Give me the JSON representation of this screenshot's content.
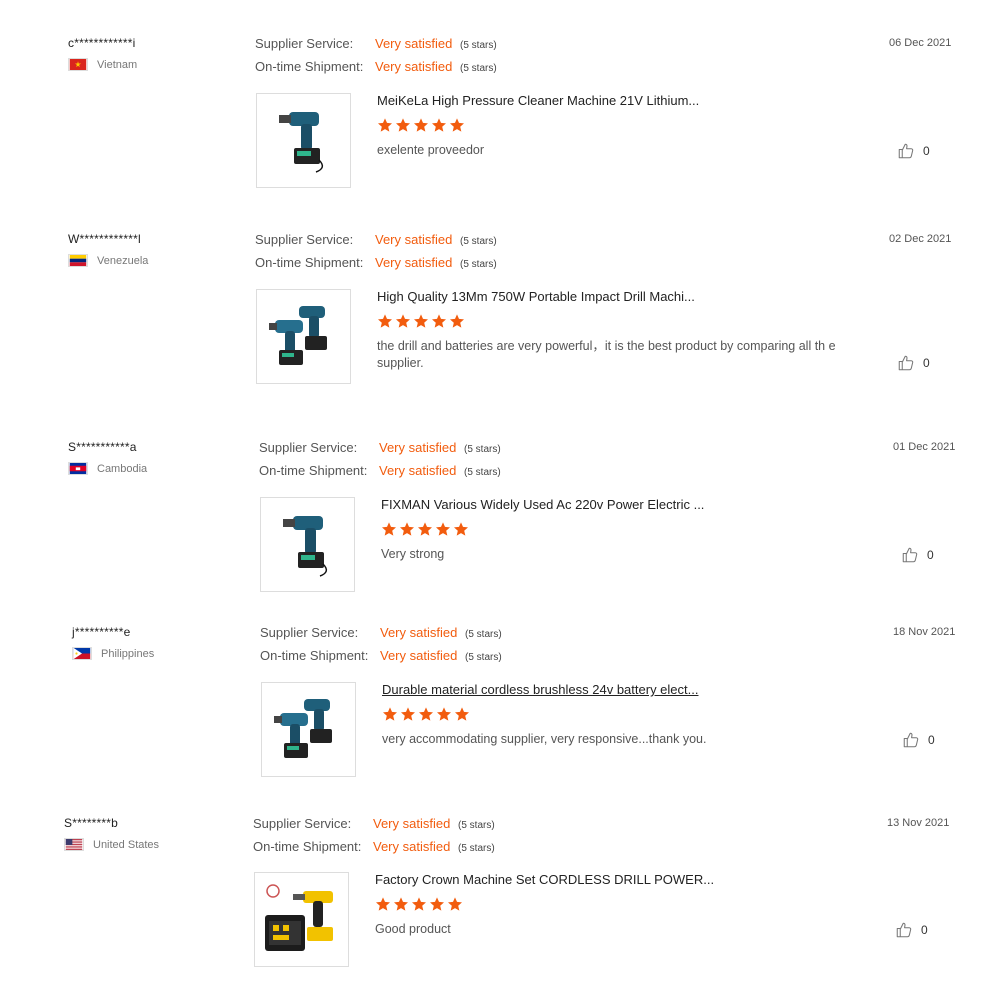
{
  "labels": {
    "supplier_service": "Supplier Service:",
    "ontime_shipment": "On-time Shipment:"
  },
  "colors": {
    "accent": "#f25c0e",
    "star": "#f25c0e"
  },
  "reviews": [
    {
      "user": "c************i",
      "country": "Vietnam",
      "flag": "vietnam",
      "supplier_service": "Very satisfied",
      "supplier_service_stars": "(5 stars)",
      "ontime_shipment": "Very satisfied",
      "ontime_shipment_stars": "(5 stars)",
      "product_title": "MeiKeLa High Pressure Cleaner Machine 21V Lithium...",
      "product_image": "impact-wrench-icon",
      "rating": 5,
      "comment": "exelente proveedor",
      "date": "06 Dec 2021",
      "likes": "0"
    },
    {
      "user": "W************l",
      "country": "Venezuela",
      "flag": "venezuela",
      "supplier_service": "Very satisfied",
      "supplier_service_stars": "(5 stars)",
      "ontime_shipment": "Very satisfied",
      "ontime_shipment_stars": "(5 stars)",
      "product_title": "High Quality 13Mm 750W Portable Impact Drill Machi...",
      "product_image": "impact-drill-pair-icon",
      "rating": 5,
      "comment": "the drill and batteries are very powerful，it is the best product by comparing all th e supplier.",
      "date": "02 Dec 2021",
      "likes": "0"
    },
    {
      "user": "S***********a",
      "country": "Cambodia",
      "flag": "cambodia",
      "supplier_service": "Very satisfied",
      "supplier_service_stars": "(5 stars)",
      "ontime_shipment": "Very satisfied",
      "ontime_shipment_stars": "(5 stars)",
      "product_title": "FIXMAN Various Widely Used Ac 220v Power Electric ...",
      "product_image": "impact-wrench-icon",
      "rating": 5,
      "comment": "Very strong",
      "date": "01 Dec 2021",
      "likes": "0"
    },
    {
      "user": "j**********e",
      "country": "Philippines",
      "flag": "philippines",
      "supplier_service": "Very satisfied",
      "supplier_service_stars": "(5 stars)",
      "ontime_shipment": "Very satisfied",
      "ontime_shipment_stars": "(5 stars)",
      "product_title": "Durable material cordless brushless 24v battery elect...",
      "product_image": "impact-drill-pair-icon",
      "rating": 5,
      "comment": "very accommodating supplier, very responsive...thank you.",
      "date": "18 Nov 2021",
      "likes": "0"
    },
    {
      "user": "S********b",
      "country": "United States",
      "flag": "usa",
      "supplier_service": "Very satisfied",
      "supplier_service_stars": "(5 stars)",
      "ontime_shipment": "Very satisfied",
      "ontime_shipment_stars": "(5 stars)",
      "product_title": "Factory Crown Machine Set CORDLESS DRILL POWER...",
      "product_image": "drill-kit-icon",
      "rating": 5,
      "comment": "Good product",
      "date": "13 Nov 2021",
      "likes": "0"
    }
  ]
}
